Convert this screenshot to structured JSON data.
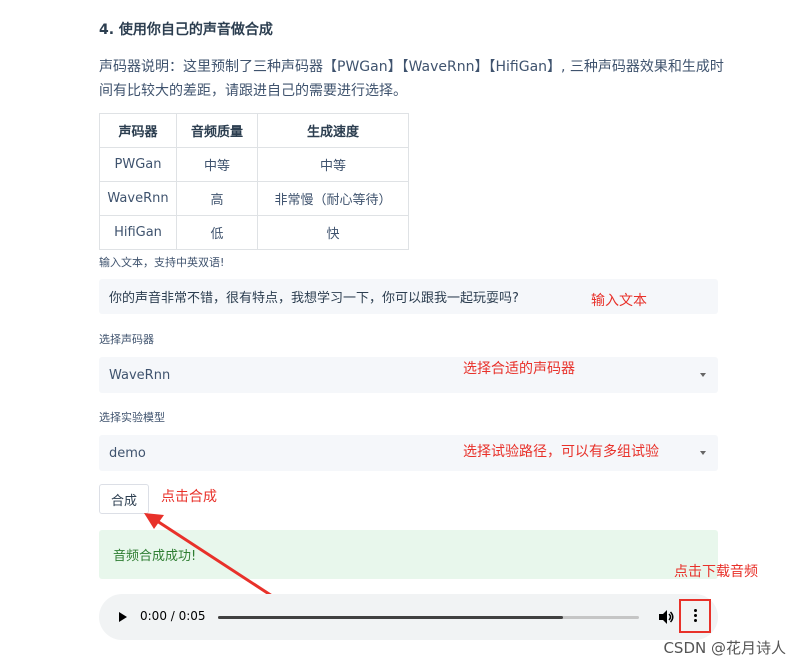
{
  "section_title": "4. 使用你自己的声音做合成",
  "description": "声码器说明：这里预制了三种声码器【PWGan】【WaveRnn】【HifiGan】, 三种声码器效果和生成时间有比较大的差距，请跟进自己的需要进行选择。",
  "vocoder_table": {
    "headers": [
      "声码器",
      "音频质量",
      "生成速度"
    ],
    "rows": [
      [
        "PWGan",
        "中等",
        "中等"
      ],
      [
        "WaveRnn",
        "高",
        "非常慢（耐心等待）"
      ],
      [
        "HifiGan",
        "低",
        "快"
      ]
    ]
  },
  "text_input": {
    "label": "输入文本，支持中英双语!",
    "value": "你的声音非常不错，很有特点，我想学习一下，你可以跟我一起玩耍吗?",
    "annotation": "输入文本"
  },
  "vocoder_select": {
    "label": "选择声码器",
    "value": "WaveRnn",
    "annotation": "选择合适的声码器"
  },
  "model_select": {
    "label": "选择实验模型",
    "value": "demo",
    "annotation": "选择试验路径，可以有多组试验"
  },
  "synthesize": {
    "button_label": "合成",
    "annotation": "点击合成"
  },
  "success_message": "音频合成成功!",
  "download_annotation": "点击下载音频",
  "audio_player": {
    "time": "0:00 / 0:05",
    "progress": 0.82
  },
  "watermark": "CSDN @花月诗人",
  "colors": {
    "annotation": "#e8312a",
    "success_bg": "#e8f7ec",
    "success_text": "#2e7d32"
  }
}
